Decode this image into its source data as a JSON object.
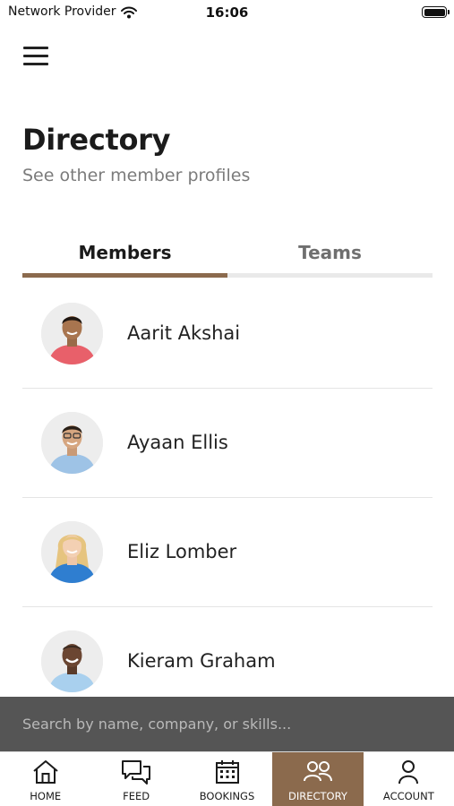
{
  "status_bar": {
    "carrier": "Network Provider",
    "time": "16:06"
  },
  "header": {
    "title": "Directory",
    "subtitle": "See other member profiles"
  },
  "tabs": [
    {
      "label": "Members",
      "active": true
    },
    {
      "label": "Teams",
      "active": false
    }
  ],
  "members": [
    {
      "name": "Aarit Akshai"
    },
    {
      "name": "Ayaan Ellis"
    },
    {
      "name": "Eliz Lomber"
    },
    {
      "name": "Kieram Graham"
    }
  ],
  "search": {
    "placeholder": "Search by name, company, or skills..."
  },
  "tab_bar": [
    {
      "label": "HOME",
      "icon": "home-icon",
      "active": false
    },
    {
      "label": "FEED",
      "icon": "feed-icon",
      "active": false
    },
    {
      "label": "BOOKINGS",
      "icon": "calendar-icon",
      "active": false
    },
    {
      "label": "DIRECTORY",
      "icon": "people-icon",
      "active": true
    },
    {
      "label": "ACCOUNT",
      "icon": "account-icon",
      "active": false
    }
  ],
  "colors": {
    "accent": "#8b6a4d",
    "search_bg": "#555555"
  }
}
